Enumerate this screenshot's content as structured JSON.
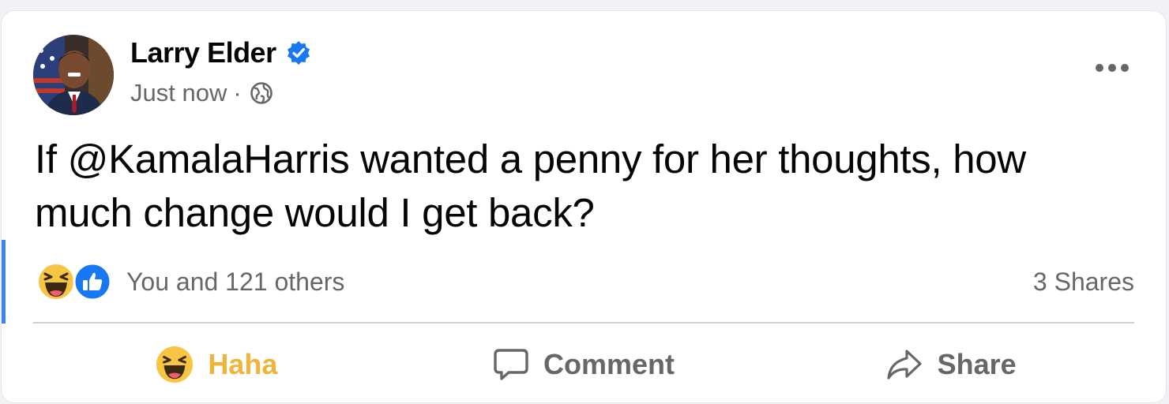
{
  "post": {
    "author": "Larry Elder",
    "time": "Just now",
    "separator": "·",
    "text": "If @KamalaHarris wanted a penny for her thoughts, how much change would I get back?",
    "reactions_summary": "You and 121 others",
    "shares": "3 Shares"
  },
  "actions": {
    "haha": "Haha",
    "comment": "Comment",
    "share": "Share"
  },
  "icons": {
    "verified": "verified-badge-icon",
    "globe": "globe-icon",
    "more": "more-options-icon",
    "haha": "haha-reaction-icon",
    "like": "like-reaction-icon",
    "comment": "comment-icon",
    "share": "share-arrow-icon"
  },
  "colors": {
    "verified": "#1877f2",
    "like": "#1877f2",
    "haha_active": "#f0b43a",
    "text_secondary": "#65676b"
  }
}
